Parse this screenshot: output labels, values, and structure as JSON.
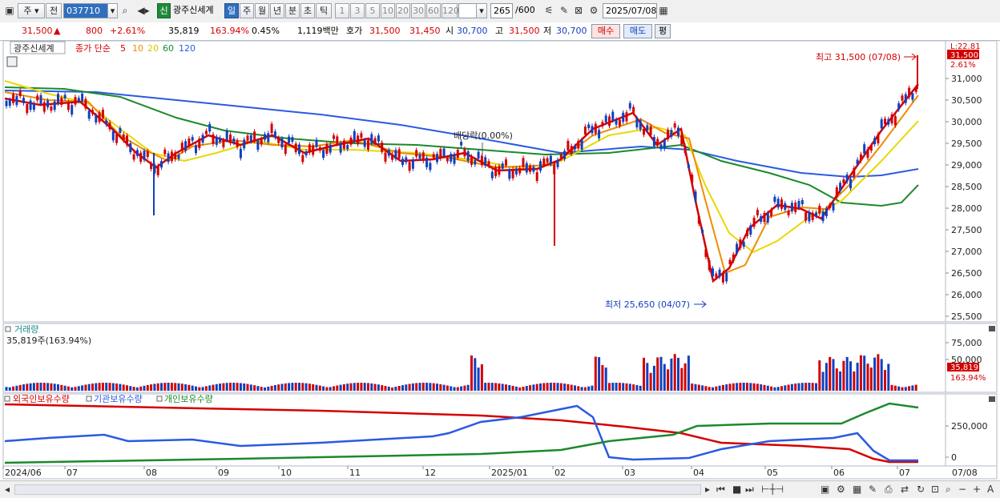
{
  "toolbar": {
    "mode_label": "주",
    "prev_label": "전",
    "code_value": "037710",
    "credit_label": "신",
    "stock_name": "광주신세계",
    "period_tabs": [
      {
        "label": "일",
        "active": true
      },
      {
        "label": "주",
        "active": false
      },
      {
        "label": "월",
        "active": false
      },
      {
        "label": "년",
        "active": false
      },
      {
        "label": "분",
        "active": false
      },
      {
        "label": "초",
        "active": false
      },
      {
        "label": "틱",
        "active": false
      }
    ],
    "interval_buttons": [
      "1",
      "3",
      "5",
      "10",
      "20",
      "30",
      "60",
      "120"
    ],
    "count_value": "265",
    "count_total": "/600",
    "date_value": "2025/07/08"
  },
  "quote": {
    "price": "31,500",
    "change": "800",
    "change_pct": "+2.61%",
    "volume": "35,819",
    "volume_ratio": "163.94%",
    "turnover": "0.45%",
    "amount": "1,119백만",
    "bid_label": "호가",
    "ask": "31,500",
    "bid": "31,450",
    "open_label": "시",
    "open": "30,700",
    "high_label": "고",
    "high": "31,500",
    "low_label": "저",
    "low": "30,700",
    "buy_label": "매수",
    "sell_label": "매도",
    "extra_label": "평"
  },
  "price_panel": {
    "name_tag": "광주신세계",
    "ma_legend": {
      "label": "종가 단순",
      "periods": [
        {
          "label": "5",
          "color": "#d40000"
        },
        {
          "label": "10",
          "color": "#f08c00"
        },
        {
          "label": "20",
          "color": "#e8d800"
        },
        {
          "label": "60",
          "color": "#1a8a2a"
        },
        {
          "label": "120",
          "color": "#2a5ae0"
        }
      ]
    },
    "axis_ticks": [
      "31,000",
      "30,500",
      "30,000",
      "29,500",
      "29,000",
      "28,500",
      "28,000",
      "27,500",
      "27,000",
      "26,500",
      "26,000",
      "25,500"
    ],
    "top_label": "L:22.81",
    "price_badge": "31,500",
    "pct_label": "2.61%",
    "high_annotation": "최고 31,500 (07/08)",
    "low_annotation": "최저 25,650 (04/07)",
    "dividend_annotation": "배당락(0.00%)"
  },
  "volume_panel": {
    "title": "거래량",
    "value_line": "35,819주(163.94%)",
    "axis_ticks": [
      "75,000",
      "50,000"
    ],
    "badge": "35,819",
    "badge_pct": "163.94%"
  },
  "holdings_panel": {
    "legend": [
      {
        "label": "외국인보유수량",
        "color": "#d40000"
      },
      {
        "label": "기관보유수량",
        "color": "#2a5ae0"
      },
      {
        "label": "개인보유수량",
        "color": "#1a8a2a"
      }
    ],
    "axis_ticks": [
      "250,000",
      "0"
    ]
  },
  "x_axis": {
    "labels": [
      "2024/06",
      "07",
      "08",
      "09",
      "10",
      "11",
      "12",
      "2025/01",
      "02",
      "03",
      "04",
      "05",
      "06",
      "07"
    ],
    "right_label": "07/08"
  },
  "colors": {
    "up": "#d40000",
    "down": "#1040c0",
    "ma5": "#d40000",
    "ma10": "#f08c00",
    "ma20": "#e8d800",
    "ma60": "#1a8a2a",
    "ma120": "#2a5ae0",
    "accent": "#2f6fbe"
  }
}
